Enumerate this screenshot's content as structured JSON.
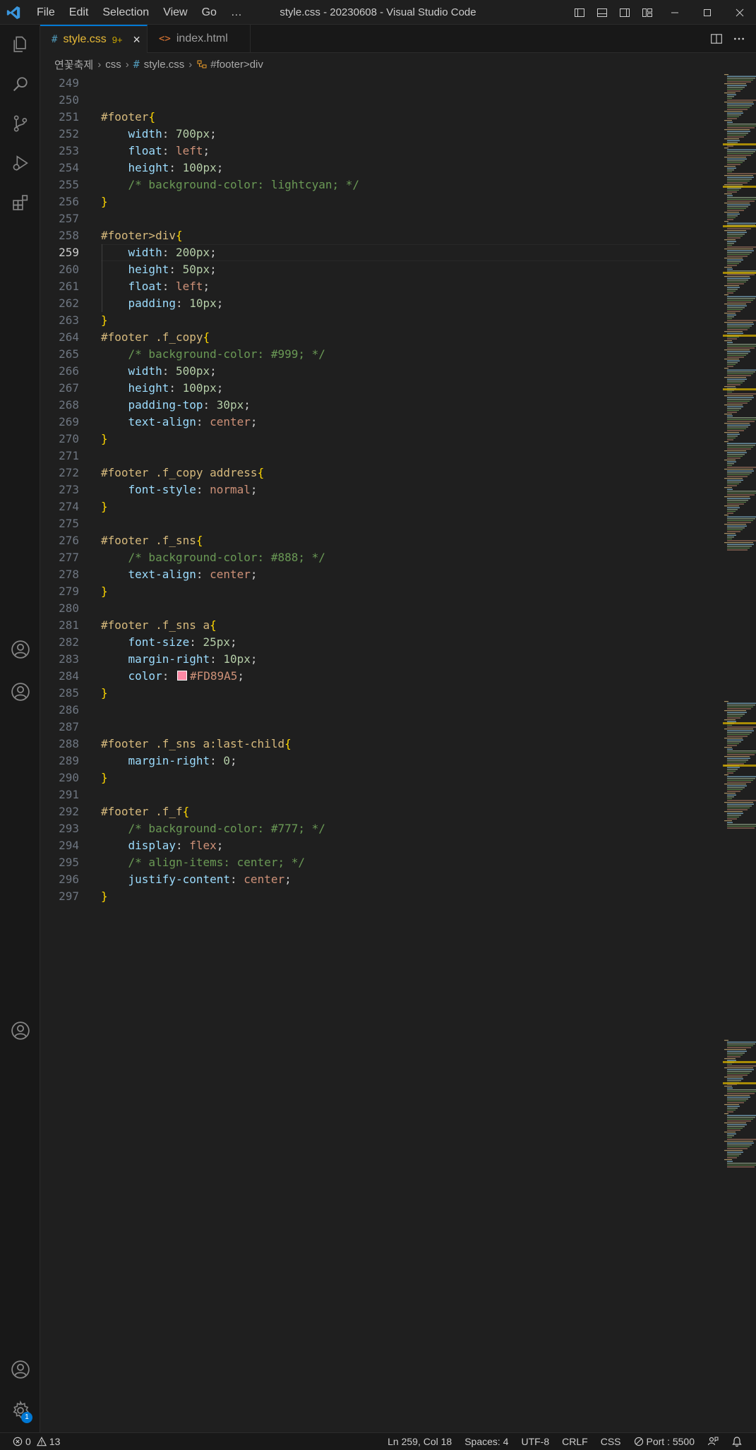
{
  "window": {
    "title": "style.css - 20230608 - Visual Studio Code"
  },
  "menu": [
    "File",
    "Edit",
    "Selection",
    "View",
    "Go",
    "…"
  ],
  "tabs": [
    {
      "icon": "#",
      "label": "style.css",
      "badge": "9+",
      "active": true
    },
    {
      "icon": "<>",
      "label": "index.html",
      "active": false
    }
  ],
  "breadcrumb": {
    "folder": "연꽃축제",
    "subfolder": "css",
    "file_icon": "#",
    "file": "style.css",
    "symbol": "#footer>div"
  },
  "editor": {
    "current_line": 259,
    "lines": [
      {
        "n": 249,
        "tokens": []
      },
      {
        "n": 250,
        "tokens": []
      },
      {
        "n": 251,
        "tokens": [
          [
            "sel",
            "#footer"
          ],
          [
            "brace",
            "{"
          ]
        ]
      },
      {
        "n": 252,
        "tokens": [
          [
            "ws",
            "    "
          ],
          [
            "prop",
            "width"
          ],
          [
            "pun",
            ": "
          ],
          [
            "num",
            "700px"
          ],
          [
            "pun",
            ";"
          ]
        ]
      },
      {
        "n": 253,
        "tokens": [
          [
            "ws",
            "    "
          ],
          [
            "prop",
            "float"
          ],
          [
            "pun",
            ": "
          ],
          [
            "val",
            "left"
          ],
          [
            "pun",
            ";"
          ]
        ]
      },
      {
        "n": 254,
        "tokens": [
          [
            "ws",
            "    "
          ],
          [
            "prop",
            "height"
          ],
          [
            "pun",
            ": "
          ],
          [
            "num",
            "100px"
          ],
          [
            "pun",
            ";"
          ]
        ]
      },
      {
        "n": 255,
        "tokens": [
          [
            "ws",
            "    "
          ],
          [
            "com",
            "/* background-color: lightcyan; */"
          ]
        ]
      },
      {
        "n": 256,
        "tokens": [
          [
            "brace",
            "}"
          ]
        ]
      },
      {
        "n": 257,
        "tokens": []
      },
      {
        "n": 258,
        "tokens": [
          [
            "sel",
            "#footer>div"
          ],
          [
            "brace",
            "{"
          ]
        ]
      },
      {
        "n": 259,
        "tokens": [
          [
            "ws",
            "    "
          ],
          [
            "prop",
            "width"
          ],
          [
            "pun",
            ": "
          ],
          [
            "num",
            "200px"
          ],
          [
            "pun",
            ";"
          ]
        ]
      },
      {
        "n": 260,
        "tokens": [
          [
            "ws",
            "    "
          ],
          [
            "prop",
            "height"
          ],
          [
            "pun",
            ": "
          ],
          [
            "num",
            "50px"
          ],
          [
            "pun",
            ";"
          ]
        ]
      },
      {
        "n": 261,
        "tokens": [
          [
            "ws",
            "    "
          ],
          [
            "prop",
            "float"
          ],
          [
            "pun",
            ": "
          ],
          [
            "val",
            "left"
          ],
          [
            "pun",
            ";"
          ]
        ]
      },
      {
        "n": 262,
        "tokens": [
          [
            "ws",
            "    "
          ],
          [
            "prop",
            "padding"
          ],
          [
            "pun",
            ": "
          ],
          [
            "num",
            "10px"
          ],
          [
            "pun",
            ";"
          ]
        ]
      },
      {
        "n": 263,
        "tokens": [
          [
            "brace",
            "}"
          ]
        ]
      },
      {
        "n": 264,
        "tokens": [
          [
            "sel",
            "#footer .f_copy"
          ],
          [
            "brace",
            "{"
          ]
        ]
      },
      {
        "n": 265,
        "tokens": [
          [
            "ws",
            "    "
          ],
          [
            "com",
            "/* background-color: #999; */"
          ]
        ]
      },
      {
        "n": 266,
        "tokens": [
          [
            "ws",
            "    "
          ],
          [
            "prop",
            "width"
          ],
          [
            "pun",
            ": "
          ],
          [
            "num",
            "500px"
          ],
          [
            "pun",
            ";"
          ]
        ]
      },
      {
        "n": 267,
        "tokens": [
          [
            "ws",
            "    "
          ],
          [
            "prop",
            "height"
          ],
          [
            "pun",
            ": "
          ],
          [
            "num",
            "100px"
          ],
          [
            "pun",
            ";"
          ]
        ]
      },
      {
        "n": 268,
        "tokens": [
          [
            "ws",
            "    "
          ],
          [
            "prop",
            "padding-top"
          ],
          [
            "pun",
            ": "
          ],
          [
            "num",
            "30px"
          ],
          [
            "pun",
            ";"
          ]
        ]
      },
      {
        "n": 269,
        "tokens": [
          [
            "ws",
            "    "
          ],
          [
            "prop",
            "text-align"
          ],
          [
            "pun",
            ": "
          ],
          [
            "val",
            "center"
          ],
          [
            "pun",
            ";"
          ]
        ]
      },
      {
        "n": 270,
        "tokens": [
          [
            "brace",
            "}"
          ]
        ]
      },
      {
        "n": 271,
        "tokens": []
      },
      {
        "n": 272,
        "tokens": [
          [
            "sel",
            "#footer .f_copy address"
          ],
          [
            "brace",
            "{"
          ]
        ]
      },
      {
        "n": 273,
        "tokens": [
          [
            "ws",
            "    "
          ],
          [
            "prop",
            "font-style"
          ],
          [
            "pun",
            ": "
          ],
          [
            "val",
            "normal"
          ],
          [
            "pun",
            ";"
          ]
        ]
      },
      {
        "n": 274,
        "tokens": [
          [
            "brace",
            "}"
          ]
        ]
      },
      {
        "n": 275,
        "tokens": []
      },
      {
        "n": 276,
        "tokens": [
          [
            "sel",
            "#footer .f_sns"
          ],
          [
            "brace",
            "{"
          ]
        ]
      },
      {
        "n": 277,
        "tokens": [
          [
            "ws",
            "    "
          ],
          [
            "com",
            "/* background-color: #888; */"
          ]
        ]
      },
      {
        "n": 278,
        "tokens": [
          [
            "ws",
            "    "
          ],
          [
            "prop",
            "text-align"
          ],
          [
            "pun",
            ": "
          ],
          [
            "val",
            "center"
          ],
          [
            "pun",
            ";"
          ]
        ]
      },
      {
        "n": 279,
        "tokens": [
          [
            "brace",
            "}"
          ]
        ]
      },
      {
        "n": 280,
        "tokens": []
      },
      {
        "n": 281,
        "tokens": [
          [
            "sel",
            "#footer .f_sns a"
          ],
          [
            "brace",
            "{"
          ]
        ]
      },
      {
        "n": 282,
        "tokens": [
          [
            "ws",
            "    "
          ],
          [
            "prop",
            "font-size"
          ],
          [
            "pun",
            ": "
          ],
          [
            "num",
            "25px"
          ],
          [
            "pun",
            ";"
          ]
        ]
      },
      {
        "n": 283,
        "tokens": [
          [
            "ws",
            "    "
          ],
          [
            "prop",
            "margin-right"
          ],
          [
            "pun",
            ": "
          ],
          [
            "num",
            "10px"
          ],
          [
            "pun",
            ";"
          ]
        ]
      },
      {
        "n": 284,
        "tokens": [
          [
            "ws",
            "    "
          ],
          [
            "prop",
            "color"
          ],
          [
            "pun",
            ": "
          ],
          [
            "swatch",
            "#FD89A5"
          ],
          [
            "val",
            "#FD89A5"
          ],
          [
            "pun",
            ";"
          ]
        ]
      },
      {
        "n": 285,
        "tokens": [
          [
            "brace",
            "}"
          ]
        ]
      },
      {
        "n": 286,
        "tokens": []
      },
      {
        "n": 287,
        "tokens": []
      },
      {
        "n": 288,
        "tokens": [
          [
            "sel",
            "#footer .f_sns a:last-child"
          ],
          [
            "brace",
            "{"
          ]
        ]
      },
      {
        "n": 289,
        "tokens": [
          [
            "ws",
            "    "
          ],
          [
            "prop",
            "margin-right"
          ],
          [
            "pun",
            ": "
          ],
          [
            "num",
            "0"
          ],
          [
            "pun",
            ";"
          ]
        ]
      },
      {
        "n": 290,
        "tokens": [
          [
            "brace",
            "}"
          ]
        ]
      },
      {
        "n": 291,
        "tokens": []
      },
      {
        "n": 292,
        "tokens": [
          [
            "sel",
            "#footer .f_f"
          ],
          [
            "brace",
            "{"
          ]
        ]
      },
      {
        "n": 293,
        "tokens": [
          [
            "ws",
            "    "
          ],
          [
            "com",
            "/* background-color: #777; */"
          ]
        ]
      },
      {
        "n": 294,
        "tokens": [
          [
            "ws",
            "    "
          ],
          [
            "prop",
            "display"
          ],
          [
            "pun",
            ": "
          ],
          [
            "val",
            "flex"
          ],
          [
            "pun",
            ";"
          ]
        ]
      },
      {
        "n": 295,
        "tokens": [
          [
            "ws",
            "    "
          ],
          [
            "com",
            "/* align-items: center; */"
          ]
        ]
      },
      {
        "n": 296,
        "tokens": [
          [
            "ws",
            "    "
          ],
          [
            "prop",
            "justify-content"
          ],
          [
            "pun",
            ": "
          ],
          [
            "val",
            "center"
          ],
          [
            "pun",
            ";"
          ]
        ]
      },
      {
        "n": 297,
        "tokens": [
          [
            "brace",
            "}"
          ]
        ]
      }
    ]
  },
  "activity_bar": {
    "top": [
      "files-icon",
      "search-icon",
      "source-control-icon",
      "run-debug-icon",
      "extensions-icon"
    ],
    "accounts_badge": "1"
  },
  "status": {
    "errors": "0",
    "warnings": "13",
    "position": "Ln 259, Col 18",
    "spaces": "Spaces: 4",
    "encoding": "UTF-8",
    "eol": "CRLF",
    "language": "CSS",
    "port": "Port : 5500"
  },
  "colors": {
    "accent": "#0078d4",
    "selector": "#d7ba7d",
    "property": "#9cdcfe",
    "number": "#b5cea8",
    "string_value": "#ce9178",
    "comment": "#6a9955",
    "brace": "#ffd700",
    "swatch": "#FD89A5",
    "warning": "#cca700"
  }
}
